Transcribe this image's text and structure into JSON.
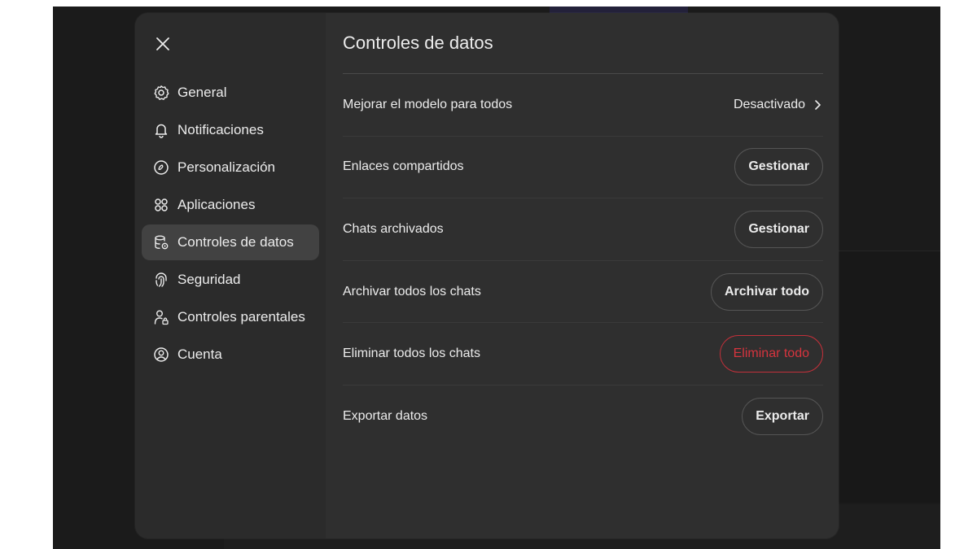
{
  "modal": {
    "title": "Controles de datos",
    "close_icon": "close-icon"
  },
  "sidebar": {
    "items": [
      {
        "label": "General",
        "icon": "gear-icon",
        "active": false
      },
      {
        "label": "Notificaciones",
        "icon": "bell-icon",
        "active": false
      },
      {
        "label": "Personalización",
        "icon": "personalization-icon",
        "active": false
      },
      {
        "label": "Aplicaciones",
        "icon": "apps-grid-icon",
        "active": false
      },
      {
        "label": "Controles de datos",
        "icon": "database-settings-icon",
        "active": true
      },
      {
        "label": "Seguridad",
        "icon": "fingerprint-icon",
        "active": false
      },
      {
        "label": "Controles parentales",
        "icon": "parental-user-icon",
        "active": false
      },
      {
        "label": "Cuenta",
        "icon": "account-circle-icon",
        "active": false
      }
    ]
  },
  "settings": {
    "improve_model": {
      "label": "Mejorar el modelo para todos",
      "value": "Desactivado"
    },
    "shared_links": {
      "label": "Enlaces compartidos",
      "button": "Gestionar"
    },
    "archived_chats": {
      "label": "Chats archivados",
      "button": "Gestionar"
    },
    "archive_all": {
      "label": "Archivar todos los chats",
      "button": "Archivar todo"
    },
    "delete_all": {
      "label": "Eliminar todos los chats",
      "button": "Eliminar todo"
    },
    "export": {
      "label": "Exportar datos",
      "button": "Exportar"
    }
  },
  "colors": {
    "modal_bg": "#2f2f2f",
    "active_nav_bg": "#424242",
    "danger": "#d6343e",
    "text": "#ececec"
  }
}
